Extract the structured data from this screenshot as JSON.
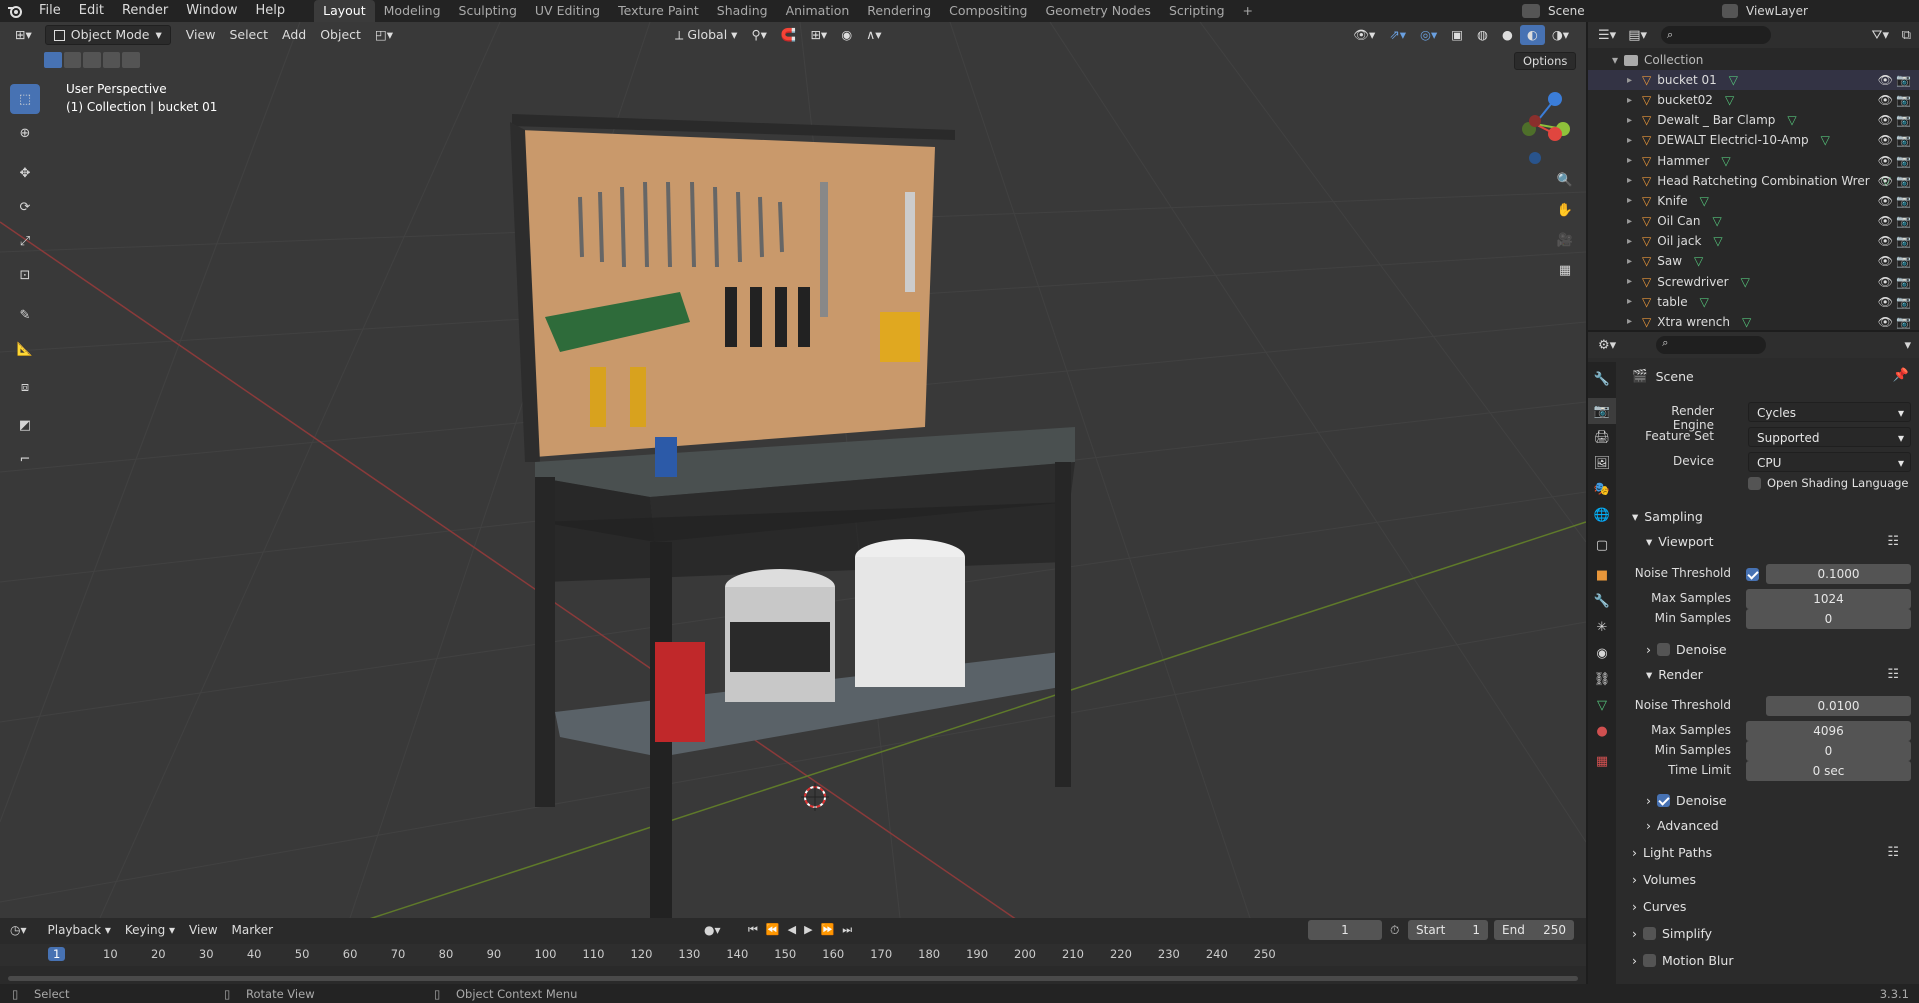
{
  "menu": [
    "File",
    "Edit",
    "Render",
    "Window",
    "Help"
  ],
  "workspaces": [
    "Layout",
    "Modeling",
    "Sculpting",
    "UV Editing",
    "Texture Paint",
    "Shading",
    "Animation",
    "Rendering",
    "Compositing",
    "Geometry Nodes",
    "Scripting"
  ],
  "active_workspace": "Layout",
  "scene_name": "Scene",
  "view_layer": "ViewLayer",
  "viewport": {
    "mode": "Object Mode",
    "menus": [
      "View",
      "Select",
      "Add",
      "Object"
    ],
    "orientation": "Global",
    "options_label": "Options",
    "overlay_title": "User Perspective",
    "overlay_subtitle": "(1) Collection | bucket 01"
  },
  "outliner": {
    "collection": "Collection",
    "items": [
      "bucket 01",
      "bucket02",
      "Dewalt _ Bar Clamp",
      "DEWALT Electricl-10-Amp",
      "Hammer",
      "Head Ratcheting Combination Wrer",
      "Knife",
      "Oil Can",
      "Oil jack",
      "Saw",
      "Screwdriver",
      "table",
      "Xtra wrench"
    ]
  },
  "properties": {
    "context": "Scene",
    "render_engine_label": "Render Engine",
    "render_engine": "Cycles",
    "feature_set_label": "Feature Set",
    "feature_set": "Supported",
    "device_label": "Device",
    "device": "CPU",
    "osl_label": "Open Shading Language",
    "sampling": "Sampling",
    "viewport_label": "Viewport",
    "noise_threshold_label": "Noise Threshold",
    "vp_noise_threshold": "0.1000",
    "max_samples_label": "Max Samples",
    "vp_max_samples": "1024",
    "min_samples_label": "Min Samples",
    "vp_min_samples": "0",
    "denoise_label": "Denoise",
    "render_label": "Render",
    "r_noise_threshold": "0.0100",
    "r_max_samples": "4096",
    "r_min_samples": "0",
    "time_limit_label": "Time Limit",
    "time_limit": "0 sec",
    "advanced": "Advanced",
    "sections": [
      "Light Paths",
      "Volumes",
      "Curves",
      "Simplify",
      "Motion Blur"
    ]
  },
  "timeline": {
    "menus": [
      "Playback",
      "Keying",
      "View",
      "Marker"
    ],
    "current_frame": "1",
    "start_label": "Start",
    "start": "1",
    "end_label": "End",
    "end": "250",
    "ticks": [
      "1",
      "10",
      "20",
      "30",
      "40",
      "50",
      "60",
      "70",
      "80",
      "90",
      "100",
      "110",
      "120",
      "130",
      "140",
      "150",
      "160",
      "170",
      "180",
      "190",
      "200",
      "210",
      "220",
      "230",
      "240",
      "250"
    ]
  },
  "status": {
    "select": "Select",
    "rotate": "Rotate View",
    "context_menu": "Object Context Menu",
    "version": "3.3.1"
  },
  "colors": {
    "accent": "#4772b3",
    "mesh_icon": "#e8963a",
    "vertex_icon": "#55c27a"
  }
}
